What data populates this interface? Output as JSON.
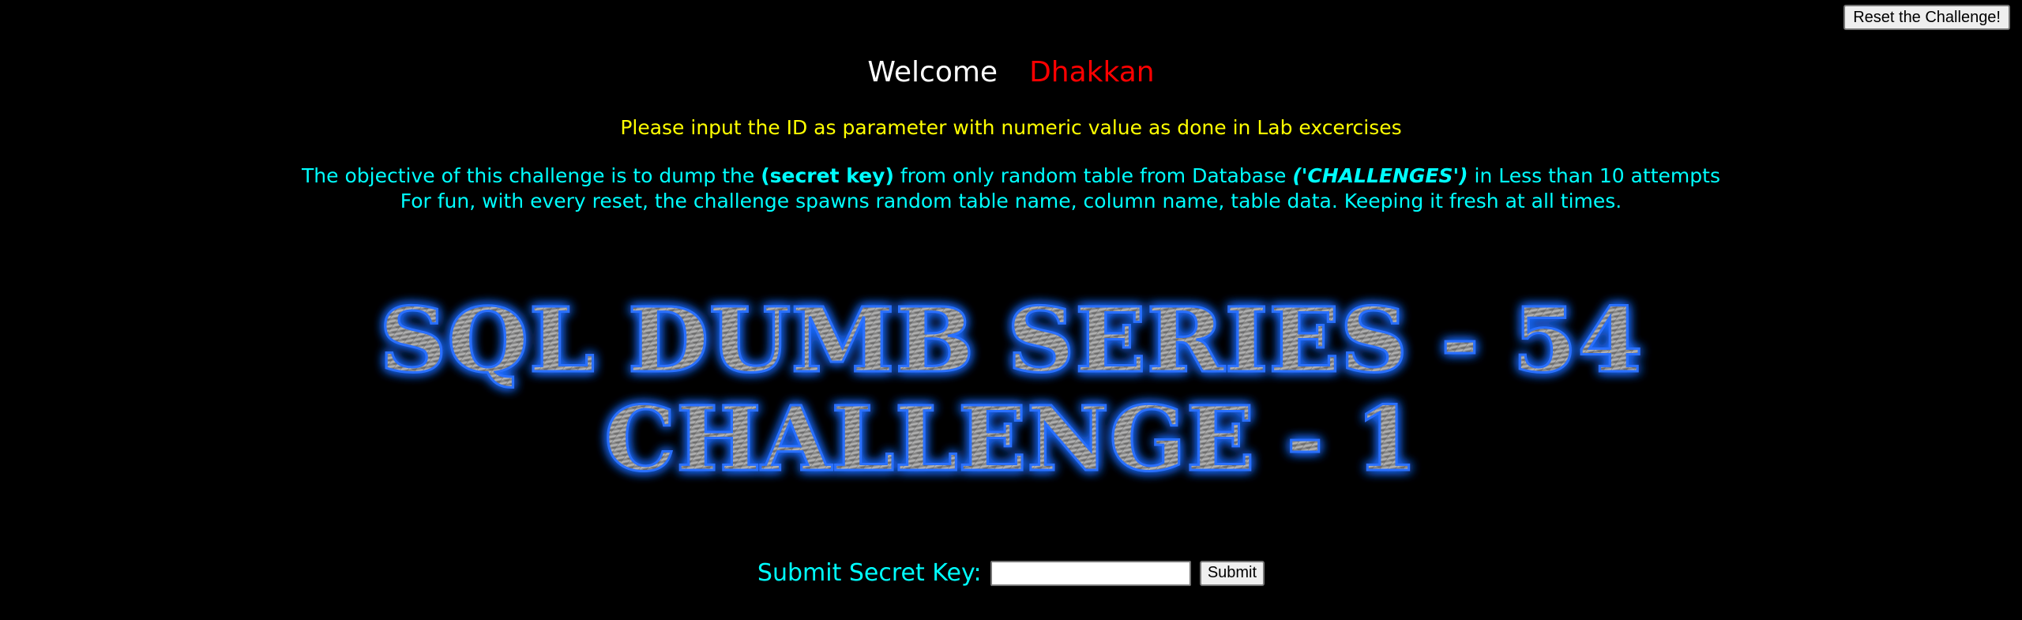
{
  "reset_button_label": "Reset the Challenge!",
  "welcome": {
    "greeting": "Welcome",
    "username": "Dhakkan"
  },
  "instruction": "Please input the ID as parameter with numeric value as done in Lab excercises",
  "objective": {
    "line1_pre": "The objective of this challenge is to dump the ",
    "line1_key": "(secret key)",
    "line1_mid": " from only random table from Database ",
    "line1_db": "('CHALLENGES')",
    "line1_post": " in Less than 10 attempts",
    "line2": "For fun, with every reset, the challenge spawns random table name, column name, table data. Keeping it fresh at all times."
  },
  "banner": {
    "line1": "SQL DUMB SERIES - 54",
    "line2": "CHALLENGE - 1"
  },
  "submit": {
    "label": "Submit Secret Key:",
    "input_value": "",
    "button_label": "Submit"
  },
  "colors": {
    "welcome": "#ffffff",
    "username": "#ff0000",
    "instruction": "#ffff00",
    "objective": "#00ffff",
    "banner_glow": "#1e6bff"
  }
}
